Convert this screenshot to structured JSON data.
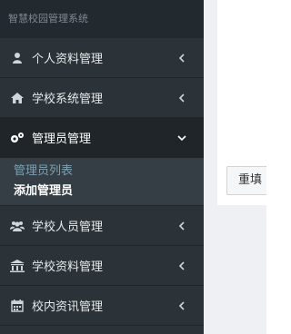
{
  "app": {
    "title": "智慧校园管理系统"
  },
  "sidebar": {
    "items": [
      {
        "label": "个人资料管理",
        "icon": "user-icon",
        "expanded": false
      },
      {
        "label": "学校系统管理",
        "icon": "home-icon",
        "expanded": false
      },
      {
        "label": "管理员管理",
        "icon": "gears-icon",
        "expanded": true,
        "children": [
          {
            "label": "管理员列表",
            "selected": false
          },
          {
            "label": "添加管理员",
            "selected": true
          }
        ]
      },
      {
        "label": "学校人员管理",
        "icon": "users-icon",
        "expanded": false
      },
      {
        "label": "学校资料管理",
        "icon": "institution-icon",
        "expanded": false
      },
      {
        "label": "校内资讯管理",
        "icon": "calendar-icon",
        "expanded": false
      }
    ]
  },
  "main": {
    "reset_label": "重填"
  },
  "colors": {
    "sidebar_bg": "#2b3338",
    "submenu_bg": "#353e44",
    "submenu_link": "#7fa0b3",
    "text_light": "#e6e9eb"
  }
}
